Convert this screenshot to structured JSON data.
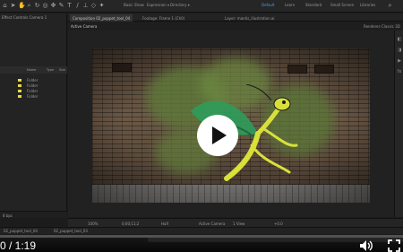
{
  "toolbar": {
    "items": [
      "Basic",
      "Show",
      "Expression ▾",
      "Directory ▾"
    ],
    "workspaces": [
      "Default",
      "Learn",
      "Standard",
      "Small Screen",
      "Libraries"
    ],
    "active_workspace": "Default"
  },
  "left_panel": {
    "tab": "Effect Controls Camera 1",
    "project_header": [
      "Name",
      "Type",
      "Size"
    ],
    "folders": [
      "Folder",
      "Folder",
      "Folder",
      "Folder"
    ],
    "folder_color": "#e6d84a",
    "bottom_label": "8 bpc"
  },
  "composition": {
    "tabs": [
      "Composition 02_puppet_tool_04",
      "Footage: Frame 1 (Ch0)",
      "Layer: mantis_illustration.ai"
    ],
    "active_tab": "Composition 02_puppet_tool_04",
    "breadcrumb_a": "02_puppet_tool_04",
    "breadcrumb_b": "02_puppet_tool_02",
    "view_label": "Active Camera",
    "renderer_label": "Renderer:",
    "renderer_value": "Classic 3D"
  },
  "viewer_footer": {
    "zoom": "100%",
    "timecode": "0;00;11;2",
    "resolution": "Half",
    "camera": "Active Camera",
    "views": "1 View",
    "offset": "+0.0"
  },
  "timeline_tabs": [
    "02_puppet_tool_04",
    "02_puppet_tool_03"
  ],
  "player": {
    "time_display": "0 / 1:19",
    "progress_fraction": 0.0,
    "accent": "#ffffff",
    "play_icon": "play-icon",
    "volume_icon": "volume-icon",
    "fullscreen_icon": "fullscreen-icon"
  }
}
